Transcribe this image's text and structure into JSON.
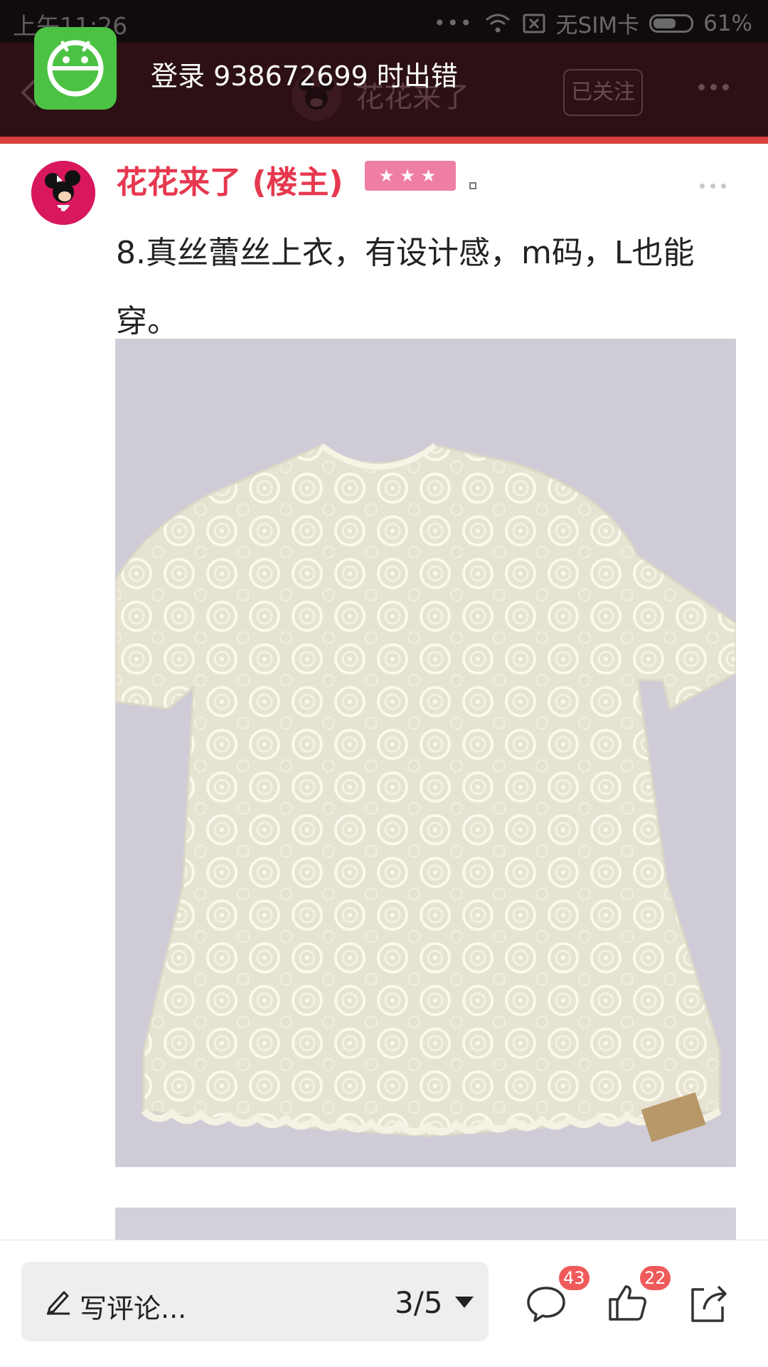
{
  "status_bar": {
    "time": "上午11:26",
    "carrier": "无SIM卡",
    "battery": "61%",
    "battery_level": 0.61
  },
  "header": {
    "title": "花花来了",
    "follow_label": "已关注"
  },
  "toast": {
    "message": "登录 938672699 时出错"
  },
  "post": {
    "author": "花花来了 (楼主)",
    "level_stars": "★★★",
    "text": "8.真丝蕾丝上衣，有设计感，m码，L也能穿。"
  },
  "bottom_bar": {
    "comment_placeholder": "写评论...",
    "page_indicator": "3/5",
    "comment_count": "43",
    "like_count": "22"
  },
  "colors": {
    "header_bg": "#2c1014",
    "accent_red": "#d9413d",
    "author_name": "#e6384f",
    "badge_pink": "#ef7fa2",
    "count_badge": "#f05a5a",
    "toast_icon_green": "#4cc244"
  }
}
